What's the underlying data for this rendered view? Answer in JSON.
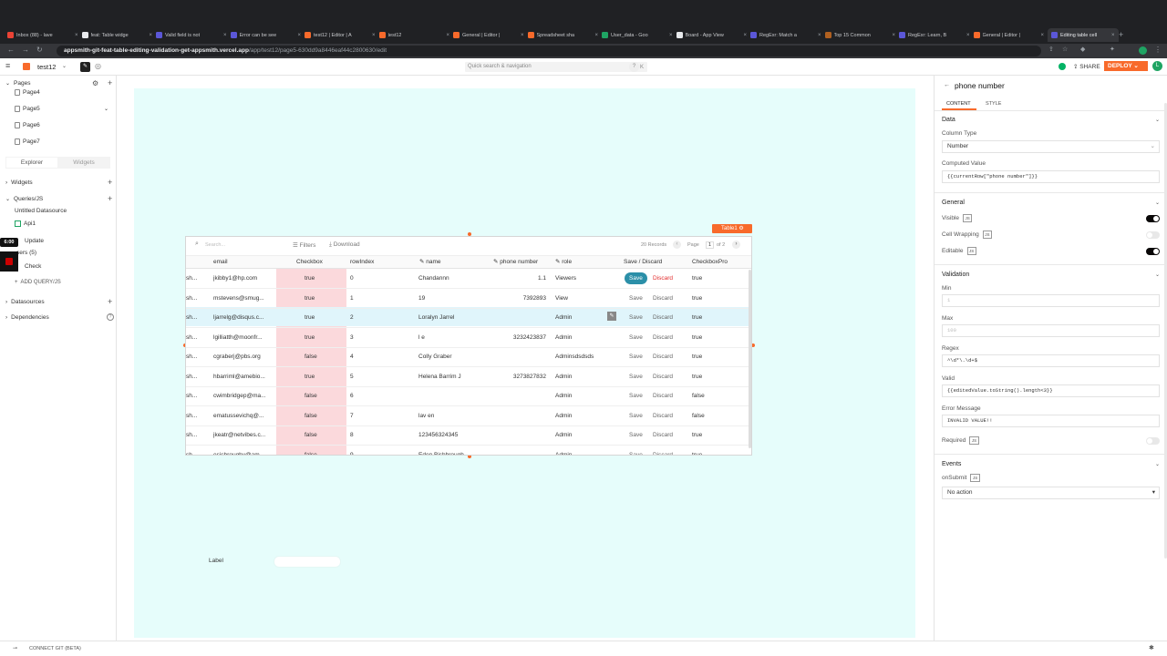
{
  "browser": {
    "tabs": [
      {
        "title": "Inbox (88) - lave",
        "color": "#ea4335"
      },
      {
        "title": "feat: Table widge",
        "color": "#e8eaed"
      },
      {
        "title": "Valid field is not",
        "color": "#5b57d8"
      },
      {
        "title": "Error can be see",
        "color": "#5b57d8"
      },
      {
        "title": "test12 | Editor | A",
        "color": "#f86a2b"
      },
      {
        "title": "test12",
        "color": "#f86a2b"
      },
      {
        "title": "General | Editor |",
        "color": "#f86a2b"
      },
      {
        "title": "Spreadsheet sha",
        "color": "#f86a2b"
      },
      {
        "title": "User_data - Goo",
        "color": "#1fa463"
      },
      {
        "title": "Board - App View",
        "color": "#e8eaed"
      },
      {
        "title": "RegExr: Match a",
        "color": "#5b57d8"
      },
      {
        "title": "Top 15 Common",
        "color": "#b06020"
      },
      {
        "title": "RegExr: Learn, B",
        "color": "#5b57d8"
      },
      {
        "title": "General | Editor |",
        "color": "#f86a2b"
      },
      {
        "title": "Editing table cell",
        "color": "#5b57d8"
      }
    ],
    "url_host": "appsmith-git-feat-table-editing-validation-get-appsmith.vercel.app",
    "url_path": "/app/test12/page5-630dd9a8446eaf44c2800630/edit"
  },
  "header": {
    "app_name": "test12",
    "search_placeholder": "Quick search & navigation",
    "search_shortcut": "⌘ K",
    "help": "?",
    "share": "SHARE",
    "deploy": "DEPLOY",
    "avatar": "L"
  },
  "sidebar": {
    "pages_title": "Pages",
    "pages": [
      "Page4",
      "Page5",
      "Page6",
      "Page7"
    ],
    "tab_explorer": "Explorer",
    "tab_widgets": "Widgets",
    "widgets": "Widgets",
    "queries": "Queries/JS",
    "datasource": "Untitled Datasource",
    "query_items": [
      "Api1",
      "Update",
      "sers (5)",
      "Check"
    ],
    "timestamp": "6:00",
    "add_query": "ADD QUERY/JS",
    "datasources": "Datasources",
    "dependencies": "Dependencies"
  },
  "table": {
    "badge": "Table1",
    "search_placeholder": "Search...",
    "filters": "Filters",
    "download": "Download",
    "records": "20 Records",
    "page_label": "Page",
    "page_num": "1",
    "page_of": "of 2",
    "columns": [
      "email",
      "Checkbox",
      "rowIndex",
      "name",
      "phone number",
      "role",
      "Save / Discard",
      "CheckboxPro"
    ],
    "save": "Save",
    "discard": "Discard",
    "rows": [
      {
        "pre": "sh...",
        "email": "jkibby1@hp.com",
        "checkbox": "true",
        "idx": "0",
        "name": "Chandannn",
        "phone": "1.1",
        "role": "Viewers",
        "pro": "true"
      },
      {
        "pre": "sh...",
        "email": "mstevens@smug...",
        "checkbox": "true",
        "idx": "1",
        "name": "19",
        "phone": "7392893",
        "role": "View",
        "pro": "true"
      },
      {
        "pre": "sh...",
        "email": "ljarrelg@disqus.c...",
        "checkbox": "true",
        "idx": "2",
        "name": "Loralyn Jarrel",
        "phone": "",
        "role": "Admin",
        "pro": "true"
      },
      {
        "pre": "sh...",
        "email": "lgilliatth@moonfr...",
        "checkbox": "true",
        "idx": "3",
        "name": "l e",
        "phone": "3232423837",
        "role": "Admin",
        "pro": "true"
      },
      {
        "pre": "sh...",
        "email": "cgraberj@pbs.org",
        "checkbox": "false",
        "idx": "4",
        "name": "Colly Graber",
        "phone": "",
        "role": "Adminsdsdsds",
        "pro": "true"
      },
      {
        "pre": "sh...",
        "email": "hbarriml@amebio...",
        "checkbox": "true",
        "idx": "5",
        "name": "Helena Barrim J",
        "phone": "3273827832",
        "role": "Admin",
        "pro": "true"
      },
      {
        "pre": "sh...",
        "email": "cwimbridgep@ma...",
        "checkbox": "false",
        "idx": "6",
        "name": "",
        "phone": "",
        "role": "Admin",
        "pro": "false"
      },
      {
        "pre": "sh...",
        "email": "ematussevichq@...",
        "checkbox": "false",
        "idx": "7",
        "name": "lav en",
        "phone": "",
        "role": "Admin",
        "pro": "false"
      },
      {
        "pre": "sh...",
        "email": "jkeatr@netvibes.c...",
        "checkbox": "false",
        "idx": "8",
        "name": "123456324345",
        "phone": "",
        "role": "Admin",
        "pro": "true"
      },
      {
        "pre": "sh...",
        "email": "esisbroughv@am...",
        "checkbox": "false",
        "idx": "9",
        "name": "Eden Bishbrough",
        "phone": "",
        "role": "Admin",
        "pro": "true"
      }
    ]
  },
  "canvas_label": "Label",
  "pane": {
    "back": "←",
    "title": "phone number",
    "tab_content": "CONTENT",
    "tab_style": "STYLE",
    "sec_data": "Data",
    "column_type_label": "Column Type",
    "column_type": "Number",
    "computed_label": "Computed Value",
    "computed_value": "{{currentRow[\"phone number\"]}}",
    "sec_general": "General",
    "visible": "Visible",
    "cell_wrapping": "Cell Wrapping",
    "editable": "Editable",
    "sec_validation": "Validation",
    "min": "Min",
    "min_placeholder": "1",
    "max": "Max",
    "max_placeholder": "100",
    "regex": "Regex",
    "regex_value": "^\\d*\\.\\d+$",
    "valid": "Valid",
    "valid_value": "{{editedValue.toString().length<3}}",
    "error_label": "Error Message",
    "error_value": "INVALID VALUE!!",
    "required": "Required",
    "sec_events": "Events",
    "on_submit": "onSubmit",
    "on_submit_value": "No action",
    "js": "JS"
  },
  "footer": {
    "connect_git": "CONNECT GIT (BETA)"
  },
  "colors": {
    "accent": "#f86a2b",
    "canvas": "#e6fdfb",
    "pink": "#fbd9dc",
    "save_active": "#2b8fa8",
    "discard_active": "#e22c2c"
  }
}
